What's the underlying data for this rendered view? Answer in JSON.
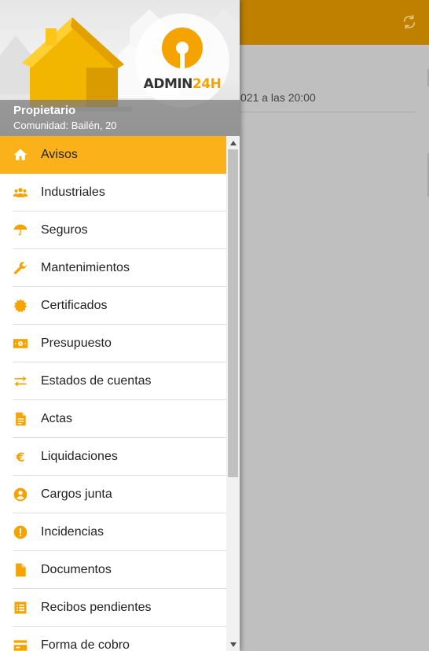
{
  "colors": {
    "accent": "#fbb21a",
    "header_dimmed": "#bf8000",
    "icon": "#f5a300"
  },
  "header": {
    "refresh_icon": "refresh-icon"
  },
  "content": {
    "notice_date": "021 a las 20:00"
  },
  "drawer": {
    "logo": {
      "part1": "ADMIN",
      "part2": "24H"
    },
    "user_role": "Propietario",
    "community": "Comunidad: Bailén, 20",
    "items": [
      {
        "label": "Avisos",
        "icon": "home-icon",
        "active": true
      },
      {
        "label": "Industriales",
        "icon": "users-icon",
        "active": false
      },
      {
        "label": "Seguros",
        "icon": "umbrella-icon",
        "active": false
      },
      {
        "label": "Mantenimientos",
        "icon": "wrench-icon",
        "active": false
      },
      {
        "label": "Certificados",
        "icon": "seal-icon",
        "active": false
      },
      {
        "label": "Presupuesto",
        "icon": "money-icon",
        "active": false
      },
      {
        "label": "Estados de cuentas",
        "icon": "swap-arrows-icon",
        "active": false
      },
      {
        "label": "Actas",
        "icon": "document-lines-icon",
        "active": false
      },
      {
        "label": "Liquidaciones",
        "icon": "euro-icon",
        "active": false
      },
      {
        "label": "Cargos junta",
        "icon": "account-circle-icon",
        "active": false
      },
      {
        "label": "Incidencias",
        "icon": "alert-circle-icon",
        "active": false
      },
      {
        "label": "Documentos",
        "icon": "file-icon",
        "active": false
      },
      {
        "label": "Recibos pendientes",
        "icon": "list-icon",
        "active": false
      },
      {
        "label": "Forma de cobro",
        "icon": "credit-card-icon",
        "active": false
      }
    ]
  }
}
